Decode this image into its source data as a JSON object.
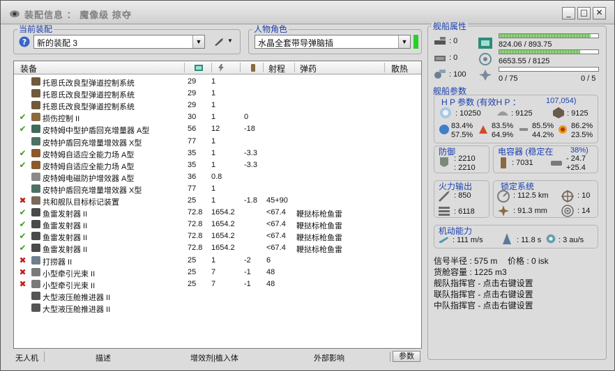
{
  "window": {
    "title": "装配信息 ： 魔像级 掠夺"
  },
  "current_fit": {
    "group_title": "当前装配",
    "fit_name": "新的装配 3"
  },
  "character": {
    "group_title": "人物角色",
    "name": "水晶全套带导弹脑插"
  },
  "columns": {
    "module": "装备",
    "range": "射程",
    "ammo": "弹药",
    "heat": "散热"
  },
  "modules": [
    {
      "status": "none",
      "icon_color": "#6f5a3a",
      "name": "托恩氏改良型弹道控制系统",
      "cpu": "29",
      "pg": "1",
      "cap": "",
      "range": "",
      "ammo": ""
    },
    {
      "status": "none",
      "icon_color": "#6f5a3a",
      "name": "托恩氏改良型弹道控制系统",
      "cpu": "29",
      "pg": "1",
      "cap": "",
      "range": "",
      "ammo": ""
    },
    {
      "status": "none",
      "icon_color": "#6f5a3a",
      "name": "托恩氏改良型弹道控制系统",
      "cpu": "29",
      "pg": "1",
      "cap": "",
      "range": "",
      "ammo": ""
    },
    {
      "status": "ok",
      "icon_color": "#8a6a3e",
      "name": "损伤控制 II",
      "cpu": "30",
      "pg": "1",
      "cap": "0",
      "range": "",
      "ammo": ""
    },
    {
      "status": "ok",
      "icon_color": "#3f6a5c",
      "name": "皮特姆中型护盾回充增量器 A型",
      "cpu": "56",
      "pg": "12",
      "cap": "-18",
      "range": "",
      "ammo": ""
    },
    {
      "status": "none",
      "icon_color": "#4d7264",
      "name": "皮特护盾回充增量增效器 X型",
      "cpu": "77",
      "pg": "1",
      "cap": "",
      "range": "",
      "ammo": ""
    },
    {
      "status": "ok",
      "icon_color": "#8a5a2e",
      "name": "皮特姆自适应全能力场 A型",
      "cpu": "35",
      "pg": "1",
      "cap": "-3.3",
      "range": "",
      "ammo": ""
    },
    {
      "status": "ok",
      "icon_color": "#8a5a2e",
      "name": "皮特姆自适应全能力场 A型",
      "cpu": "35",
      "pg": "1",
      "cap": "-3.3",
      "range": "",
      "ammo": ""
    },
    {
      "status": "none",
      "icon_color": "#8a8a8a",
      "name": "皮特姆电磁防护增效器 A型",
      "cpu": "36",
      "pg": "0.8",
      "cap": "",
      "range": "",
      "ammo": ""
    },
    {
      "status": "none",
      "icon_color": "#4d7264",
      "name": "皮特护盾回充增量增效器 X型",
      "cpu": "77",
      "pg": "1",
      "cap": "",
      "range": "",
      "ammo": ""
    },
    {
      "status": "bad",
      "icon_color": "#7a6a5a",
      "name": "共和舰队目标标记装置",
      "cpu": "25",
      "pg": "1",
      "cap": "-1.8",
      "range": "45+90",
      "ammo": ""
    },
    {
      "status": "ok",
      "icon_color": "#4a4a4a",
      "name": "鱼雷发射器 II",
      "cpu": "72.8",
      "pg": "1654.2",
      "cap": "",
      "range": "<67.4",
      "ammo": "鞭挞标枪鱼雷"
    },
    {
      "status": "ok",
      "icon_color": "#4a4a4a",
      "name": "鱼雷发射器 II",
      "cpu": "72.8",
      "pg": "1654.2",
      "cap": "",
      "range": "<67.4",
      "ammo": "鞭挞标枪鱼雷"
    },
    {
      "status": "ok",
      "icon_color": "#4a4a4a",
      "name": "鱼雷发射器 II",
      "cpu": "72.8",
      "pg": "1654.2",
      "cap": "",
      "range": "<67.4",
      "ammo": "鞭挞标枪鱼雷"
    },
    {
      "status": "ok",
      "icon_color": "#4a4a4a",
      "name": "鱼雷发射器 II",
      "cpu": "72.8",
      "pg": "1654.2",
      "cap": "",
      "range": "<67.4",
      "ammo": "鞭挞标枪鱼雷"
    },
    {
      "status": "bad",
      "icon_color": "#6f7f8f",
      "name": "打捞器 II",
      "cpu": "25",
      "pg": "1",
      "cap": "-2",
      "range": "6",
      "ammo": ""
    },
    {
      "status": "bad",
      "icon_color": "#7a7a7a",
      "name": "小型牵引光束 II",
      "cpu": "25",
      "pg": "7",
      "cap": "-1",
      "range": "48",
      "ammo": ""
    },
    {
      "status": "bad",
      "icon_color": "#7a7a7a",
      "name": "小型牵引光束 II",
      "cpu": "25",
      "pg": "7",
      "cap": "-1",
      "range": "48",
      "ammo": ""
    },
    {
      "status": "none",
      "icon_color": "#555555",
      "name": "大型液压舱推进器 II",
      "cpu": "",
      "pg": "",
      "cap": "",
      "range": "",
      "ammo": ""
    },
    {
      "status": "none",
      "icon_color": "#555555",
      "name": "大型液压舱推进器 II",
      "cpu": "",
      "pg": "",
      "cap": "",
      "range": "",
      "ammo": ""
    }
  ],
  "bottom_tabs": {
    "drones": "无人机",
    "description": "描述",
    "boosters": "增效剂|植入体",
    "external": "外部影响",
    "params": "参数"
  },
  "ship_attributes": {
    "group_title": "舰船属性",
    "turret_hardpoints": ": 0",
    "launcher_hardpoints": ": 0",
    "calibration": ": 100",
    "cpu_text": "824.06 / 893.75",
    "cpu_fraction": 0.922,
    "pg_text": "6653.55 / 8125",
    "pg_fraction": 0.819,
    "drone_bay": "0 / 75",
    "drone_bandwidth": "0 / 5"
  },
  "ship_params": {
    "group_title": "舰船参数",
    "hp_label": "H P 参数 (有效H P ：",
    "ehp": "107,054)",
    "shield_hp": ": 10250",
    "armor_hp": ": 9125",
    "hull_hp": ": 9125",
    "shield_res": [
      "83.4%",
      "57.5%"
    ],
    "armor_res": [
      "83.5%",
      "64.9%"
    ],
    "hull_res": [
      "85.5%",
      "44.2%"
    ],
    "other_res": [
      "86.2%",
      "23.5%"
    ],
    "defense_title": "防御",
    "defense_1": ": 2210",
    "defense_2": ": 2210",
    "capacitor_title": "电容器 (稳定在",
    "capacitor_stable": "38%)",
    "capacitor_value": ": 7031",
    "capacitor_delta_1": "- 24.7",
    "capacitor_delta_2": "+25.4",
    "firepower_title": "火力输出",
    "dps": ": 850",
    "volley": ": 6118",
    "targeting_title": "锁定系统",
    "lock_range": ": 112.5 km",
    "max_targets": ": 10",
    "scan_res": ": 91.3 mm",
    "sensor_strength": ": 14",
    "mobility_title": "机动能力",
    "velocity": ": 111 m/s",
    "agility": ": 11.8 s",
    "warp_speed": ": 3 au/s",
    "signature": "信号半径 : 575 m",
    "price": "价格 : 0 isk",
    "cargo": "货舱容量 : 1225 m3",
    "fleet_booster": "舰队指挥官 - 点击右键设置",
    "wing_booster": "联队指挥官 - 点击右键设置",
    "squad_booster": "中队指挥官 - 点击右键设置"
  }
}
